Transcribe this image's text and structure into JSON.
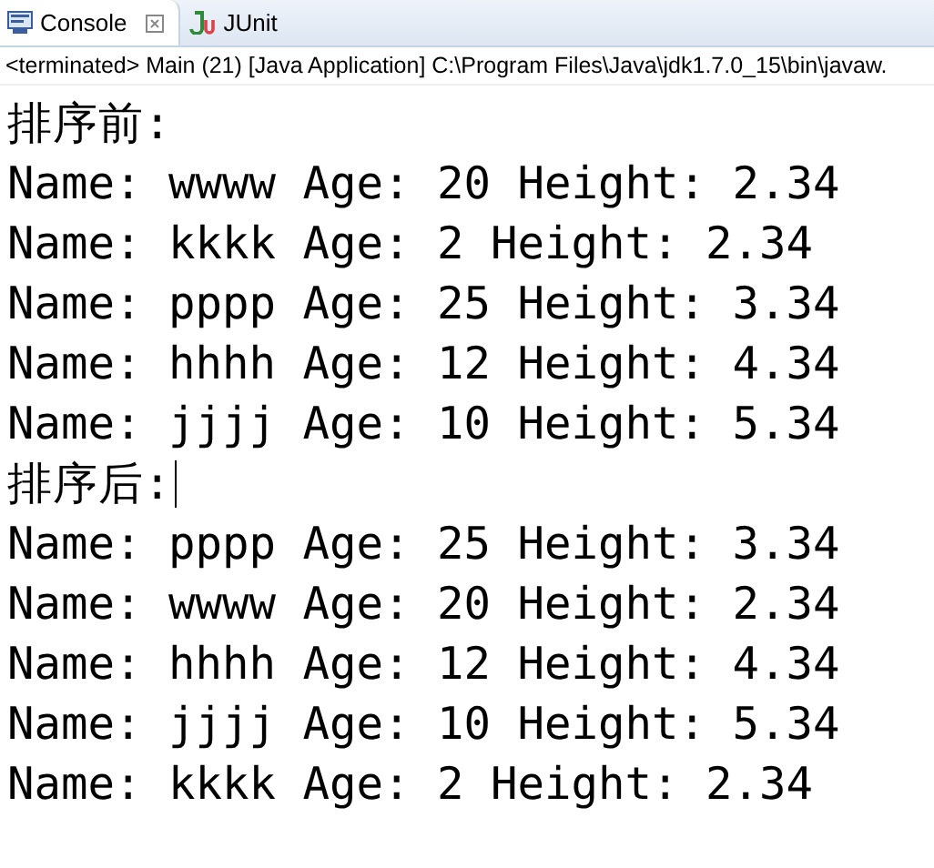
{
  "tabs": [
    {
      "label": "Console",
      "selected": true,
      "kind": "console"
    },
    {
      "label": "JUnit",
      "selected": false,
      "kind": "junit"
    }
  ],
  "status": "<terminated> Main (21) [Java Application] C:\\Program Files\\Java\\jdk1.7.0_15\\bin\\javaw.",
  "output": [
    {
      "text": "排序前:",
      "cursor": false
    },
    {
      "text": "Name: wwww Age: 20 Height: 2.34",
      "cursor": false
    },
    {
      "text": "Name: kkkk Age: 2 Height: 2.34",
      "cursor": false
    },
    {
      "text": "Name: pppp Age: 25 Height: 3.34",
      "cursor": false
    },
    {
      "text": "Name: hhhh Age: 12 Height: 4.34",
      "cursor": false
    },
    {
      "text": "Name: jjjj Age: 10 Height: 5.34",
      "cursor": false
    },
    {
      "text": "排序后:",
      "cursor": true
    },
    {
      "text": "Name: pppp Age: 25 Height: 3.34",
      "cursor": false
    },
    {
      "text": "Name: wwww Age: 20 Height: 2.34",
      "cursor": false
    },
    {
      "text": "Name: hhhh Age: 12 Height: 4.34",
      "cursor": false
    },
    {
      "text": "Name: jjjj Age: 10 Height: 5.34",
      "cursor": false
    },
    {
      "text": "Name: kkkk Age: 2 Height: 2.34",
      "cursor": false
    }
  ]
}
